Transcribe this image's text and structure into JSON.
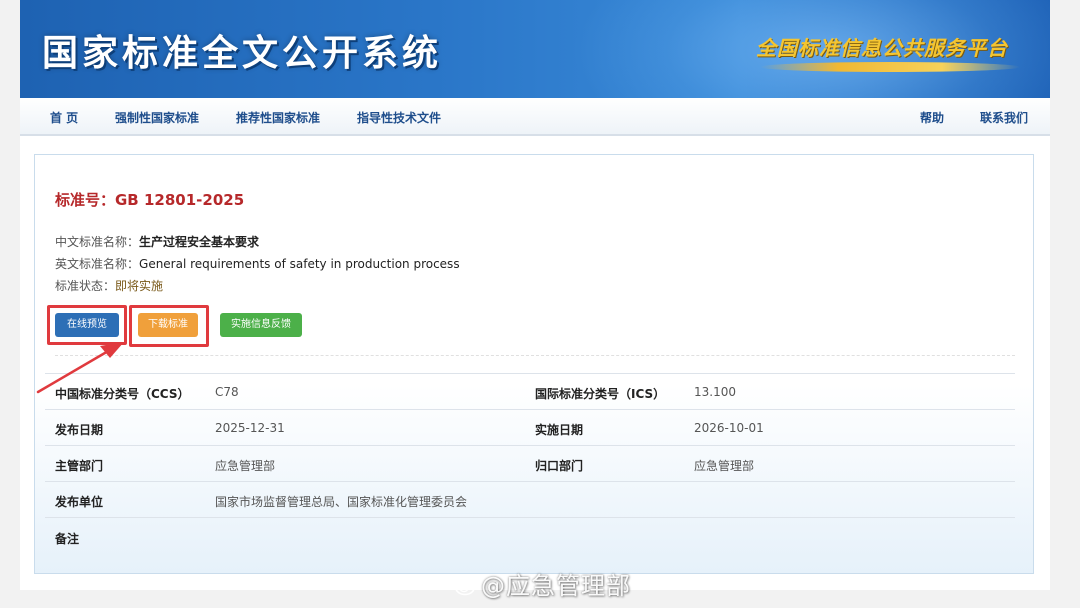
{
  "banner": {
    "title": "国家标准全文公开系统",
    "slogan": "全国标准信息公共服务平台"
  },
  "nav": {
    "items": [
      "首 页",
      "强制性国家标准",
      "推荐性国家标准",
      "指导性技术文件"
    ],
    "help": "帮助",
    "contact": "联系我们"
  },
  "standard": {
    "number": "标准号：GB 12801-2025",
    "cn_name_label": "中文标准名称：",
    "cn_name": "生产过程安全基本要求",
    "en_name_label": "英文标准名称：",
    "en_name": "General requirements of safety in production process",
    "status_label": "标准状态：",
    "status": "即将实施"
  },
  "buttons": {
    "preview": "在线预览",
    "download": "下载标准",
    "feedback": "实施信息反馈"
  },
  "details": {
    "ccs_label": "中国标准分类号（CCS）",
    "ccs": "C78",
    "ics_label": "国际标准分类号（ICS）",
    "ics": "13.100",
    "pub_date_label": "发布日期",
    "pub_date": "2025-12-31",
    "impl_date_label": "实施日期",
    "impl_date": "2026-10-01",
    "authority_label": "主管部门",
    "authority": "应急管理部",
    "owner_label": "归口部门",
    "owner": "应急管理部",
    "publisher_label": "发布单位",
    "publisher": "国家市场监督管理总局、国家标准化管理委员会",
    "remark_label": "备注"
  },
  "watermark": "@应急管理部",
  "colors": {
    "banner": "#2a76c8",
    "title_red": "#b6282a",
    "highlight": "#e03a3e",
    "btn_blue": "#2d6fb6",
    "btn_orange": "#f0a03b",
    "btn_green": "#4cb049"
  }
}
